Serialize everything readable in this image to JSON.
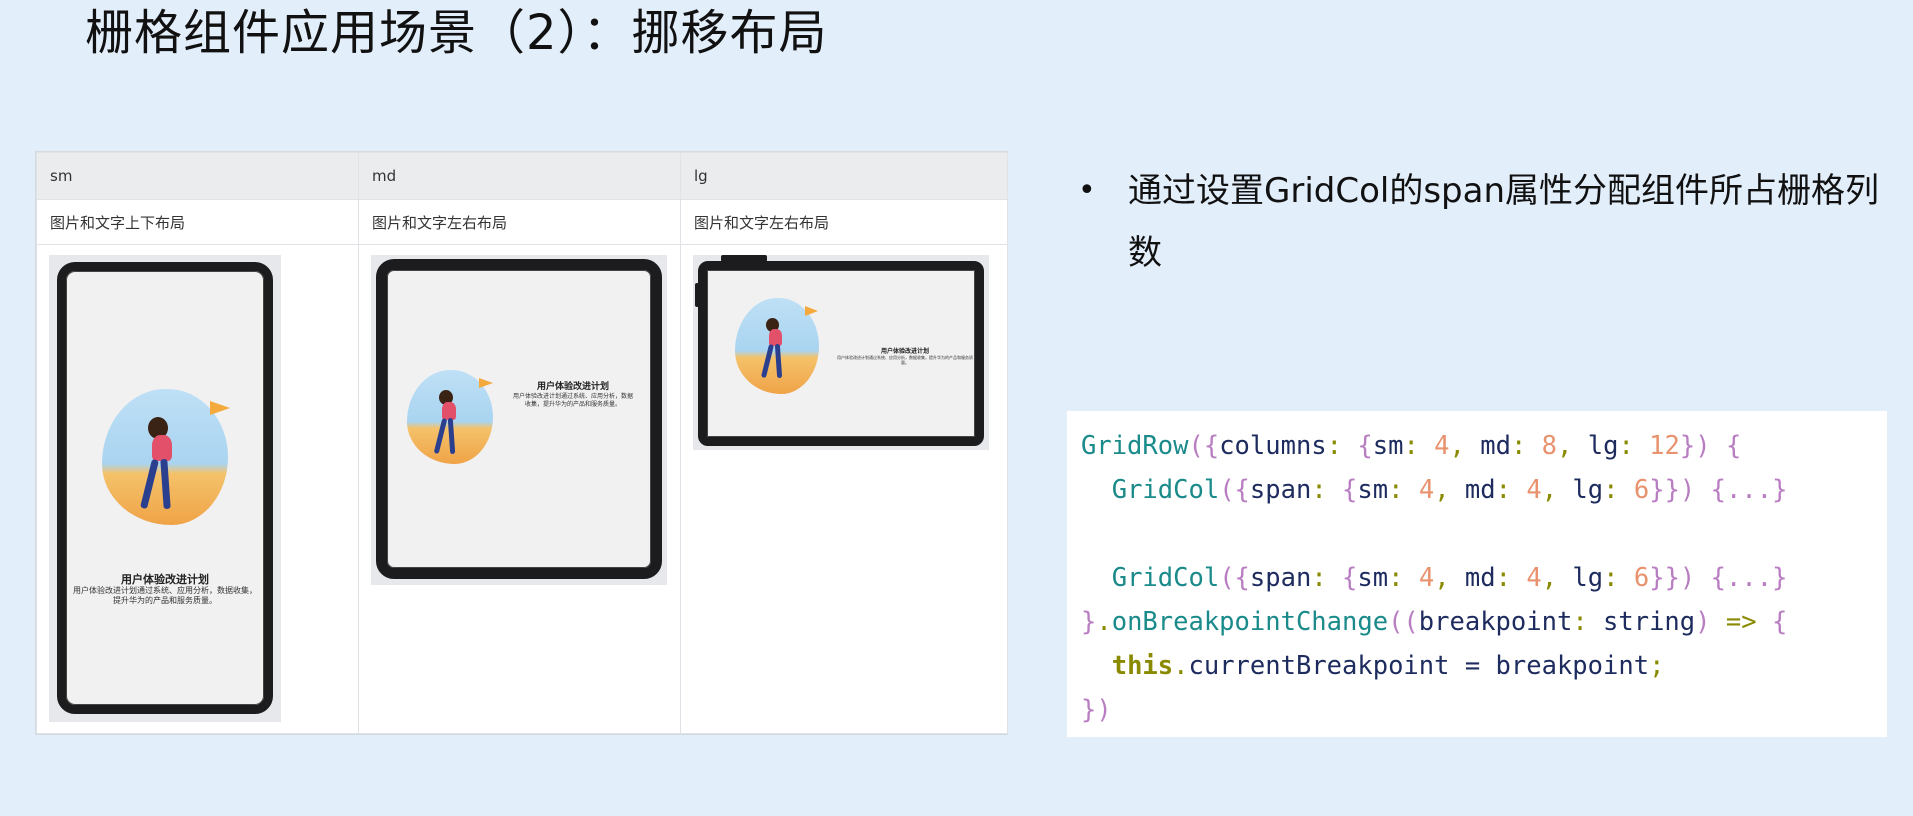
{
  "title": "栅格组件应用场景（2）：挪移布局",
  "table": {
    "headers": [
      "sm",
      "md",
      "lg"
    ],
    "descriptions": [
      "图片和文字上下布局",
      "图片和文字左右布局",
      "图片和文字左右布局"
    ],
    "caption_title": "用户体验改进计划",
    "caption_text": "用户体验改进计划通过系统、应用分析，数据收集，提升华为的产品和服务质量。"
  },
  "bullet": {
    "text": "通过设置GridCol的span属性分配组件所占栅格列数"
  },
  "code": {
    "lines": [
      "GridRow({columns: {sm: 4, md: 8, lg: 12}) {",
      "  GridCol({span: {sm: 4, md: 4, lg: 6}}) {...}",
      "",
      "  GridCol({span: {sm: 4, md: 4, lg: 6}}) {...}",
      "}.onBreakpointChange((breakpoint: string) => {",
      "  this.currentBreakpoint = breakpoint;",
      "})"
    ]
  },
  "colors": {
    "background": "#e3eefb",
    "code_function": "#1a8a8a",
    "code_bracket": "#b97dc2",
    "code_number": "#e8936e",
    "code_keyword": "#8a8a00"
  }
}
